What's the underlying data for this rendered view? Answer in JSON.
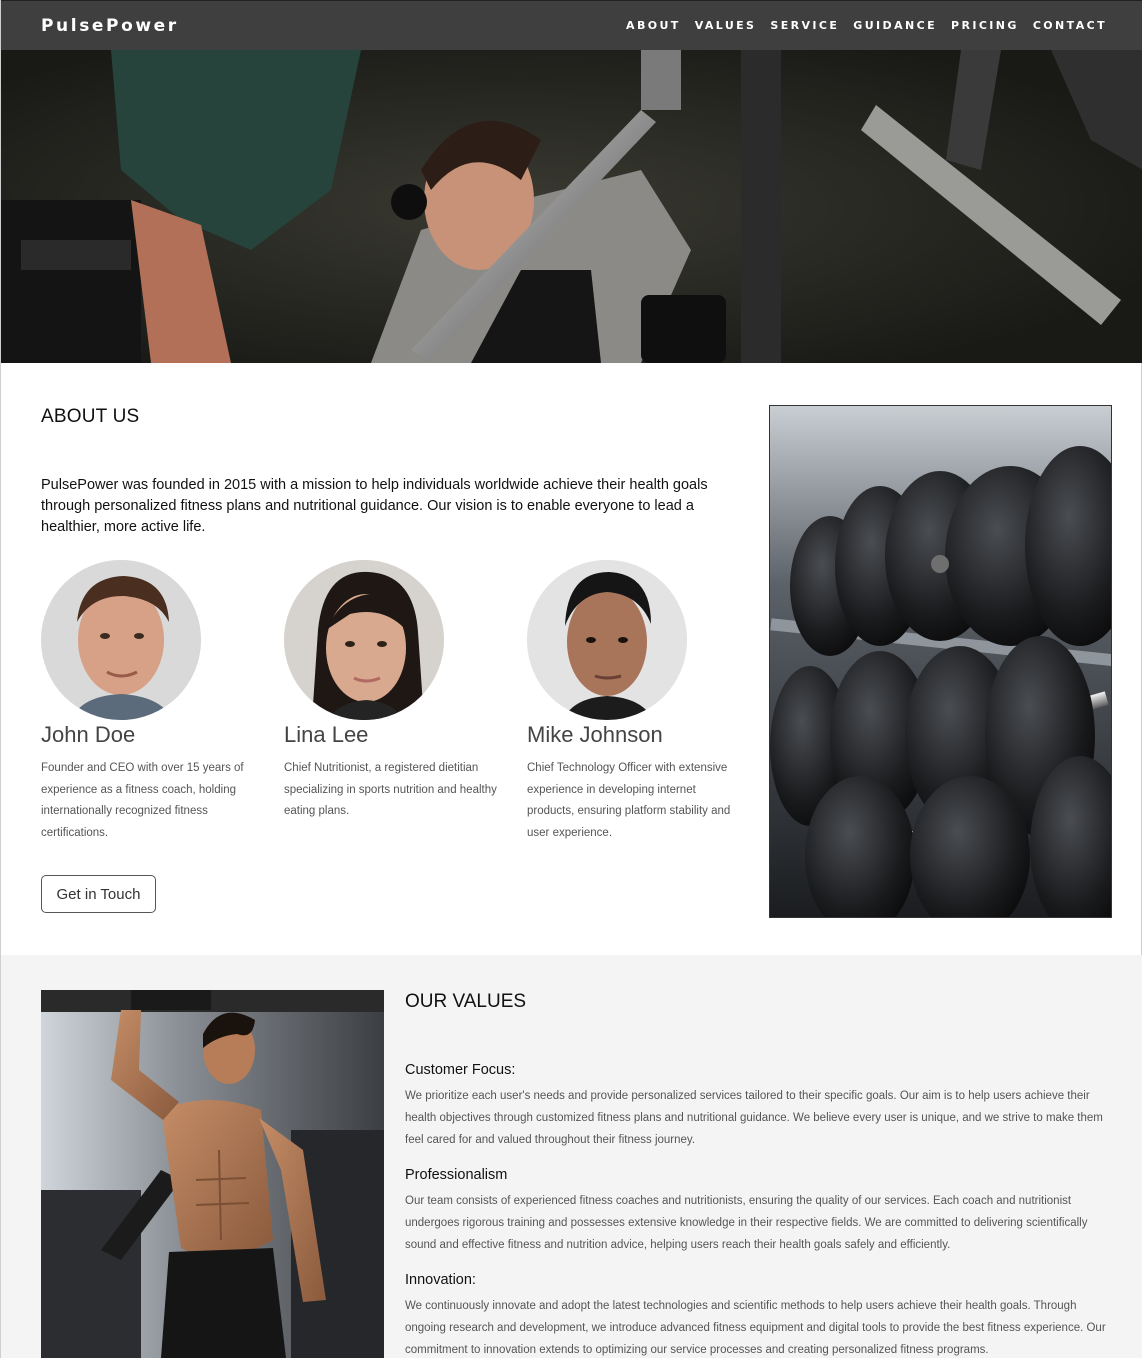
{
  "nav": {
    "brand": "PulsePower",
    "links": [
      "ABOUT",
      "VALUES",
      "SERVICE",
      "GUIDANCE",
      "PRICING",
      "CONTACT"
    ]
  },
  "about": {
    "title": "ABOUT US",
    "description": "PulsePower was founded in 2015 with a mission to help individuals worldwide achieve their health goals through personalized fitness plans and nutritional guidance. Our vision is to enable everyone to lead a healthier, more active life.",
    "team": [
      {
        "name": "John Doe",
        "bio": "Founder and CEO with over 15 years of experience as a fitness coach, holding internationally recognized fitness certifications."
      },
      {
        "name": "Lina Lee",
        "bio": "Chief Nutritionist, a registered dietitian specializing in sports nutrition and healthy eating plans."
      },
      {
        "name": "Mike Johnson",
        "bio": "Chief Technology Officer with extensive experience in developing internet products, ensuring platform stability and user experience."
      }
    ],
    "cta_label": "Get in Touch"
  },
  "values": {
    "title": "OUR VALUES",
    "items": [
      {
        "heading": "Customer Focus:",
        "text": "We prioritize each user's needs and provide personalized services tailored to their specific goals. Our aim is to help users achieve their health objectives through customized fitness plans and nutritional guidance. We believe every user is unique, and we strive to make them feel cared for and valued throughout their fitness journey."
      },
      {
        "heading": "Professionalism",
        "text": "Our team consists of experienced fitness coaches and nutritionists, ensuring the quality of our services. Each coach and nutritionist undergoes rigorous training and possesses extensive knowledge in their respective fields. We are committed to delivering scientifically sound and effective fitness and nutrition advice, helping users reach their health goals safely and efficiently."
      },
      {
        "heading": "Innovation:",
        "text": "We continuously innovate and adopt the latest technologies and scientific methods to help users achieve their health goals. Through ongoing research and development, we introduce advanced fitness equipment and digital tools to provide the best fitness experience. Our commitment to innovation extends to optimizing our service processes and creating personalized fitness programs."
      }
    ]
  },
  "colors": {
    "navbar": "#3f3f3f",
    "values_bg": "#f4f4f4",
    "text_muted": "#555555"
  },
  "icons": [
    "hero-photo",
    "dumbbell-rack-photo",
    "athlete-photo",
    "avatar-john",
    "avatar-lina",
    "avatar-mike"
  ]
}
